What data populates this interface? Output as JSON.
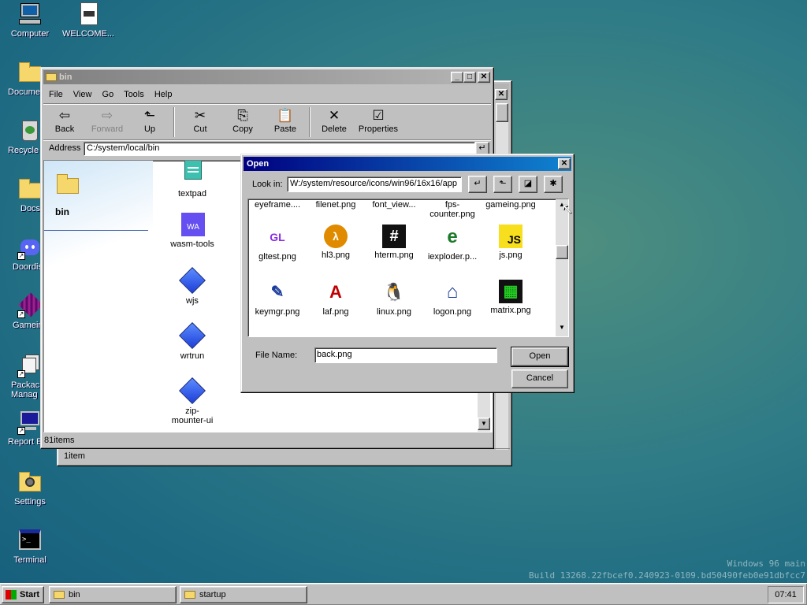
{
  "desktop": {
    "icons": [
      {
        "label": "Computer",
        "icon": "computer-icon"
      },
      {
        "label": "WELCOME...",
        "icon": "document-icon"
      },
      {
        "label": "Docume",
        "icon": "folder-icon"
      },
      {
        "label": "Recycle",
        "icon": "recycle-bin-icon"
      },
      {
        "label": "Docs",
        "icon": "folder-icon"
      },
      {
        "label": "Doordis",
        "icon": "discord-icon"
      },
      {
        "label": "Gamein",
        "icon": "game-icon"
      },
      {
        "label": "Packac Manag",
        "icon": "package-icon"
      },
      {
        "label": "Report E",
        "icon": "report-icon"
      },
      {
        "label": "Settings",
        "icon": "settings-icon"
      },
      {
        "label": "Terminal",
        "icon": "terminal-icon"
      }
    ],
    "watermark_line1": "Windows 96 main",
    "watermark_line2": "Build 13268.22fbcef0.240923-0109.bd50490feb0e91dbfcc7"
  },
  "back_window": {
    "status": "1item"
  },
  "explorer": {
    "title": "bin",
    "menu": [
      "File",
      "View",
      "Go",
      "Tools",
      "Help"
    ],
    "toolbar": {
      "back": "Back",
      "forward": "Forward",
      "up": "Up",
      "cut": "Cut",
      "copy": "Copy",
      "paste": "Paste",
      "delete": "Delete",
      "properties": "Properties"
    },
    "address_label": "Address",
    "address_value": "C:/system/local/bin",
    "sidebar_title": "bin",
    "items": [
      {
        "label": "textpad",
        "icon": "textpad-icon"
      },
      {
        "label": "wasm-tools",
        "icon": "wasm-icon",
        "glyph": "WA"
      },
      {
        "label": "wjs",
        "icon": "diamond-icon"
      },
      {
        "label": "wrtrun",
        "icon": "diamond-icon"
      },
      {
        "label": "zip-mounter-ui",
        "icon": "diamond-icon"
      }
    ],
    "status": "81items"
  },
  "open_dialog": {
    "title": "Open",
    "look_in_label": "Look in:",
    "look_in_value": "W:/system/resource/icons/win96/16x16/app",
    "top_row": [
      "eyeframe....",
      "filenet.png",
      "font_view...",
      "fps-counter.png",
      "gameing.png"
    ],
    "files": [
      {
        "label": "gltest.png",
        "icon": "gltest-icon",
        "glyph": "GL",
        "color": "#8a2be2"
      },
      {
        "label": "hl3.png",
        "icon": "half-life-icon",
        "glyph": "λ",
        "color": "#e08a00"
      },
      {
        "label": "hterm.png",
        "icon": "hterm-icon",
        "glyph": "#",
        "color": "#ffffff"
      },
      {
        "label": "iexploder.p...",
        "icon": "iexploder-icon",
        "glyph": "e",
        "color": "#1a7a2a"
      },
      {
        "label": "js.png",
        "icon": "js-icon",
        "glyph": "JS",
        "color": "#000000"
      },
      {
        "label": "keymgr.png",
        "icon": "keymgr-icon",
        "glyph": "✎",
        "color": "#1a3a9a"
      },
      {
        "label": "laf.png",
        "icon": "laf-icon",
        "glyph": "A",
        "color": "#c00000"
      },
      {
        "label": "linux.png",
        "icon": "linux-icon",
        "glyph": "🐧",
        "color": "#000000"
      },
      {
        "label": "logon.png",
        "icon": "logon-icon",
        "glyph": "⌂",
        "color": "#1a3a9a"
      },
      {
        "label": "matrix.png",
        "icon": "matrix-icon",
        "glyph": "▦",
        "color": "#22cc22"
      }
    ],
    "file_name_label": "File Name:",
    "file_name_value": "back.png",
    "open_label": "Open",
    "cancel_label": "Cancel"
  },
  "taskbar": {
    "start": "Start",
    "tasks": [
      "bin",
      "startup"
    ],
    "clock": "07:41"
  }
}
